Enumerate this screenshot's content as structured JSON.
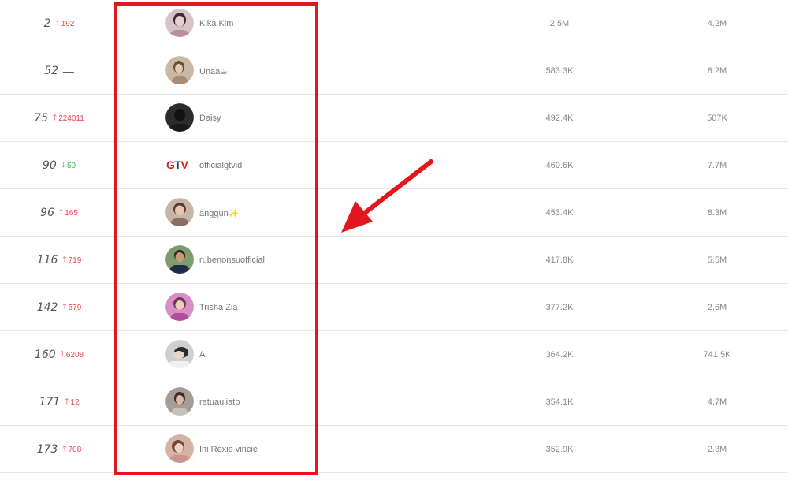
{
  "colors": {
    "accent_red": "#e3161d",
    "up": "#e9474d",
    "down": "#3fbf3f"
  },
  "rows": [
    {
      "rank": "2",
      "change": {
        "dir": "up",
        "value": "192"
      },
      "name": "Kika Kim",
      "avatar": "avatar-photo",
      "followers": "2.5M",
      "views": "4.2M"
    },
    {
      "rank": "52",
      "change": {
        "dir": "none",
        "value": "—"
      },
      "name": "Unaa☕",
      "avatar": "avatar-photo",
      "followers": "583.3K",
      "views": "8.2M"
    },
    {
      "rank": "75",
      "change": {
        "dir": "up",
        "value": "224011"
      },
      "name": "Daisy",
      "avatar": "avatar-photo",
      "followers": "492.4K",
      "views": "507K"
    },
    {
      "rank": "90",
      "change": {
        "dir": "down",
        "value": "50"
      },
      "name": "officialgtvid",
      "avatar": "gtv-logo",
      "logo_text": "GTV",
      "followers": "460.6K",
      "views": "7.7M"
    },
    {
      "rank": "96",
      "change": {
        "dir": "up",
        "value": "165"
      },
      "name": "anggun✨",
      "avatar": "avatar-photo",
      "followers": "453.4K",
      "views": "8.3M"
    },
    {
      "rank": "116",
      "change": {
        "dir": "up",
        "value": "719"
      },
      "name": "rubenonsuofficial",
      "avatar": "avatar-photo",
      "followers": "417.8K",
      "views": "5.5M"
    },
    {
      "rank": "142",
      "change": {
        "dir": "up",
        "value": "579"
      },
      "name": "Trisha Zia",
      "avatar": "avatar-photo",
      "followers": "377.2K",
      "views": "2.6M"
    },
    {
      "rank": "160",
      "change": {
        "dir": "up",
        "value": "6208"
      },
      "name": "Al",
      "avatar": "avatar-photo",
      "followers": "364.2K",
      "views": "741.5K"
    },
    {
      "rank": "171",
      "change": {
        "dir": "up",
        "value": "12"
      },
      "name": "ratuauliatp",
      "avatar": "avatar-photo",
      "followers": "354.1K",
      "views": "4.7M"
    },
    {
      "rank": "173",
      "change": {
        "dir": "up",
        "value": "708"
      },
      "name": "Ini Rexie vincie",
      "avatar": "avatar-photo",
      "followers": "352.9K",
      "views": "2.3M"
    }
  ]
}
